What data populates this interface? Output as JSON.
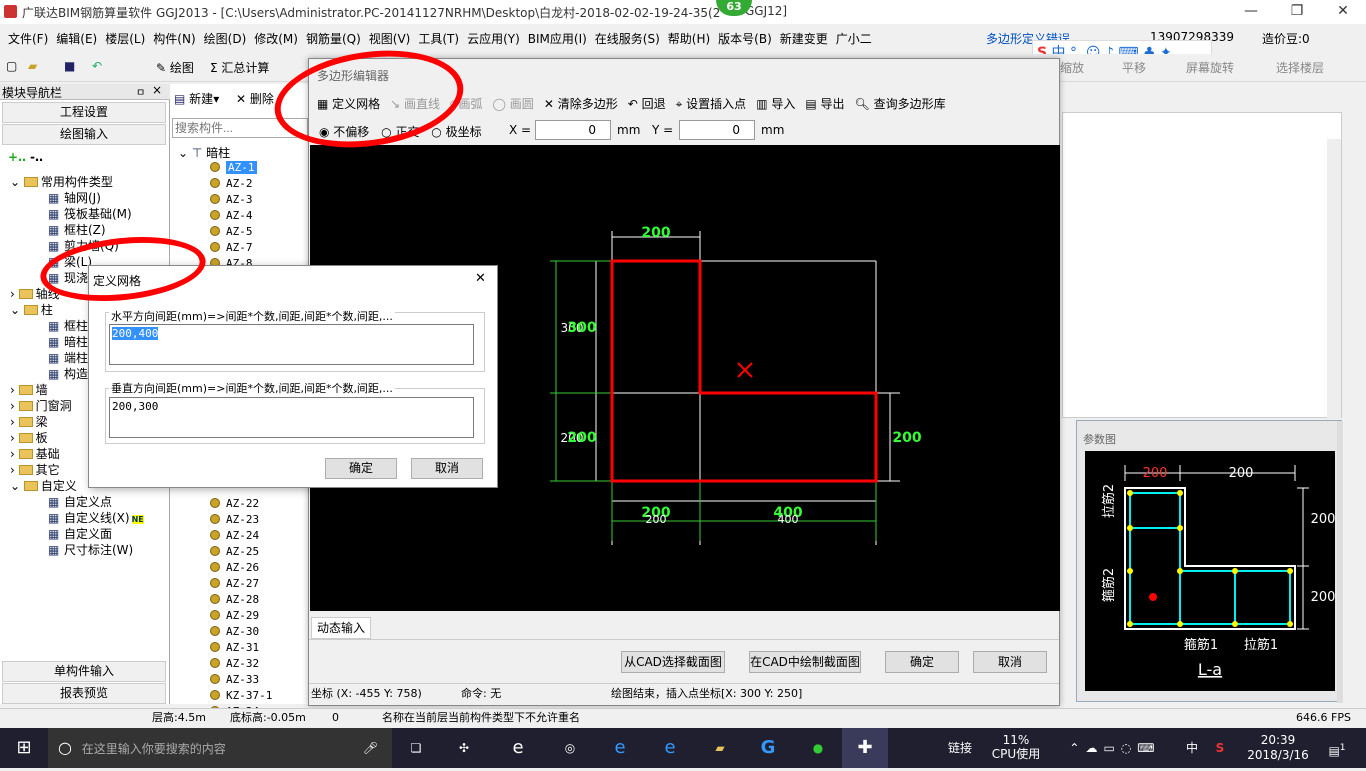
{
  "window": {
    "title": "广联达BIM钢筋算量软件 GGJ2013 - [C:\\Users\\Administrator.PC-20141127NRHM\\Desktop\\白龙村-2018-02-02-19-24-35(2",
    "title2": "GGJ12]",
    "badge": "63",
    "min": "—",
    "max": "❐",
    "close": "✕"
  },
  "menu": [
    "文件(F)",
    "编辑(E)",
    "楼层(L)",
    "构件(N)",
    "绘图(D)",
    "修改(M)",
    "钢筋量(Q)",
    "视图(V)",
    "工具(T)",
    "云应用(Y)",
    "BIM应用(I)",
    "在线服务(S)",
    "帮助(H)",
    "版本号(B)",
    "新建变更",
    "广小二"
  ],
  "menu_right": {
    "error": "多边形定义错误",
    "phone": "13907298339",
    "price": "造价豆:0"
  },
  "toolbar": {
    "draw": "绘图",
    "sum": "汇总计算",
    "zoom": "缩放",
    "pan": "平移",
    "rotate": "屏幕旋转",
    "select_floor": "选择楼层"
  },
  "nav": {
    "header": "模块导航栏",
    "pin": "ㅁ",
    "close": "×",
    "btn1": "工程设置",
    "btn2": "绘图输入",
    "btn3": "单构件输入",
    "btn4": "报表预览",
    "tree": [
      "常用构件类型",
      "轴网(J)",
      "筏板基础(M)",
      "框柱(Z)",
      "剪力墙(Q)",
      "梁(L)",
      "现浇",
      "轴线",
      "柱",
      "框柱",
      "暗柱",
      "端柱",
      "构造",
      "墙",
      "门窗洞",
      "梁",
      "板",
      "基础",
      "其它",
      "自定义",
      "自定义点",
      "自定义线(X)",
      "自定义面",
      "尺寸标注(W)"
    ],
    "new_tag": "NE"
  },
  "list": {
    "new": "新建",
    "delete": "删除",
    "search_ph": "搜索构件...",
    "root": "暗柱",
    "items_top": [
      "AZ-1",
      "AZ-2",
      "AZ-3",
      "AZ-4",
      "AZ-5",
      "AZ-7",
      "AZ-8"
    ],
    "items_bottom": [
      "AZ-22",
      "AZ-23",
      "AZ-24",
      "AZ-25",
      "AZ-26",
      "AZ-27",
      "AZ-28",
      "AZ-29",
      "AZ-30",
      "AZ-31",
      "AZ-32",
      "AZ-33",
      "KZ-37-1",
      "AZ-34"
    ]
  },
  "poly": {
    "title": "多边形编辑器",
    "tools": [
      "定义网格",
      "画直线",
      "画弧",
      "画圆",
      "清除多边形",
      "回退",
      "设置插入点",
      "导入",
      "导出",
      "查询多边形库"
    ],
    "coord_options": [
      "不偏移",
      "正交",
      "极坐标"
    ],
    "x_label": "X =",
    "x_value": "0",
    "y_label": "Y =",
    "y_value": "0",
    "unit": "mm",
    "dyn_input": "动态输入",
    "btn_cad_select": "从CAD选择截面图",
    "btn_cad_draw": "在CAD中绘制截面图",
    "ok": "确定",
    "cancel": "取消",
    "status_coord": "坐标 (X: -455 Y: 758)",
    "status_cmd": "命令: 无",
    "status_msg": "绘图结束，插入点坐标[X: 300 Y: 250]",
    "dims": {
      "top": "200",
      "left_top": "300",
      "left_top_b": "300",
      "left_bot": "200",
      "left_bot_b": "200",
      "right": "200",
      "bot1": "200",
      "bot1b": "200",
      "bot2": "400",
      "bot2b": "400"
    }
  },
  "grid": {
    "title": "定义网格",
    "close": "✕",
    "h_label": "水平方向间距(mm)=>间距*个数,间距,间距*个数,间距,...",
    "h_value": "200,400",
    "v_label": "垂直方向间距(mm)=>间距*个数,间距,间距*个数,间距,...",
    "v_value": "200,300",
    "ok": "确定",
    "cancel": "取消"
  },
  "param": {
    "title": "参数图",
    "d1": "200",
    "d2": "200",
    "d3": "200",
    "d4": "200",
    "l1": "拉筋2",
    "l2": "箍筋2",
    "l3": "箍筋1",
    "l4": "拉筋1",
    "name": "L-a"
  },
  "status": {
    "floor_h": "层高:4.5m",
    "base_h": "底标高:-0.05m",
    "num": "0",
    "msg": "名称在当前层当前构件类型下不允许重名",
    "fps": "646.6 FPS"
  },
  "taskbar": {
    "search": "在这里输入你要搜索的内容",
    "link": "链接",
    "cpu": "11%",
    "cpu_label": "CPU使用",
    "lang": "中",
    "time": "20:39",
    "date": "2018/3/16",
    "notif": "1"
  }
}
